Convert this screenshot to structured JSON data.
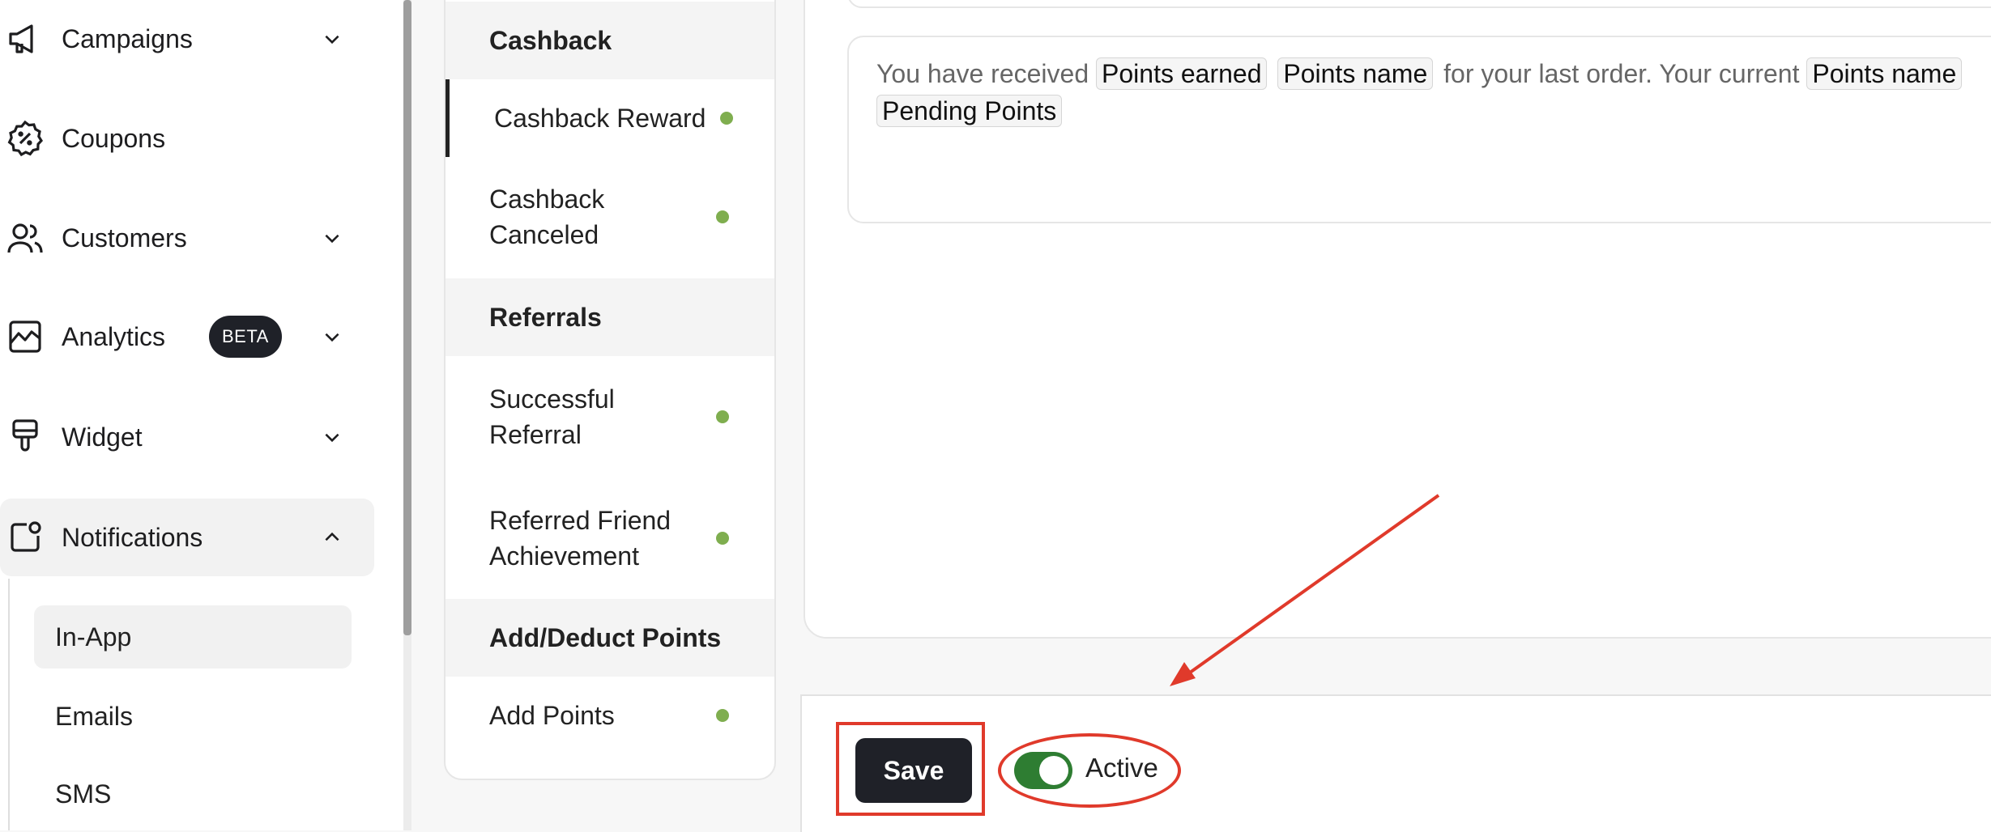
{
  "sidebar": {
    "items": [
      {
        "label": "Campaigns",
        "icon": "megaphone-icon"
      },
      {
        "label": "Coupons",
        "icon": "coupon-percent-icon"
      },
      {
        "label": "Customers",
        "icon": "users-icon"
      },
      {
        "label": "Analytics",
        "icon": "chart-icon",
        "badge": "BETA"
      },
      {
        "label": "Widget",
        "icon": "paint-brush-icon"
      },
      {
        "label": "Notifications",
        "icon": "notification-icon"
      }
    ],
    "sub_items": [
      "In-App",
      "Emails",
      "SMS"
    ]
  },
  "templates": {
    "cashback_header": "Cashback",
    "cashback_reward": "Cashback Reward",
    "cashback_canceled": "Cashback Canceled",
    "referrals_header": "Referrals",
    "successful_referral": "Successful Referral",
    "referred_friend": "Referred Friend Achievement",
    "add_deduct_header": "Add/Deduct Points",
    "add_points": "Add Points"
  },
  "editor": {
    "text_1": "You have received",
    "chip_points_earned": "Points earned",
    "chip_points_name": "Points name",
    "text_2": "for your last order. Your current",
    "chip_points_name_2": "Points name",
    "chip_pending_points": "Pending Points"
  },
  "footer": {
    "save_label": "Save",
    "active_label": "Active",
    "active_on": true
  },
  "colors": {
    "annotation_red": "#e03a2b",
    "toggle_green": "#2e7d32",
    "status_dot_green": "#7fae4f",
    "dark_button": "#1f2128"
  }
}
